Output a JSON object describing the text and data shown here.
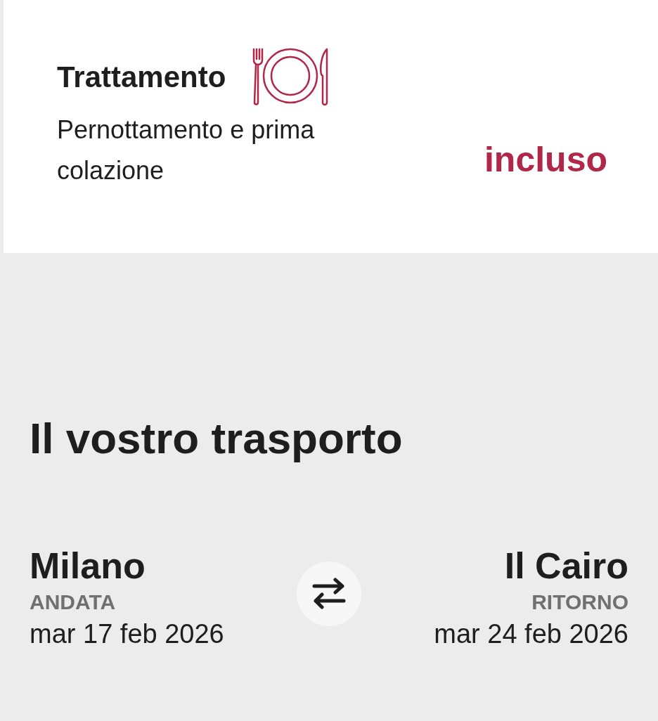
{
  "board": {
    "title": "Trattamento",
    "description": "Pernottamento e prima colazione",
    "price": "incluso"
  },
  "transport": {
    "title": "Il vostro trasporto",
    "outbound": {
      "city": "Milano",
      "label": "ANDATA",
      "date": "mar 17 feb 2026"
    },
    "return": {
      "city": "Il Cairo",
      "label": "RITORNO",
      "date": "mar 24 feb 2026"
    }
  }
}
